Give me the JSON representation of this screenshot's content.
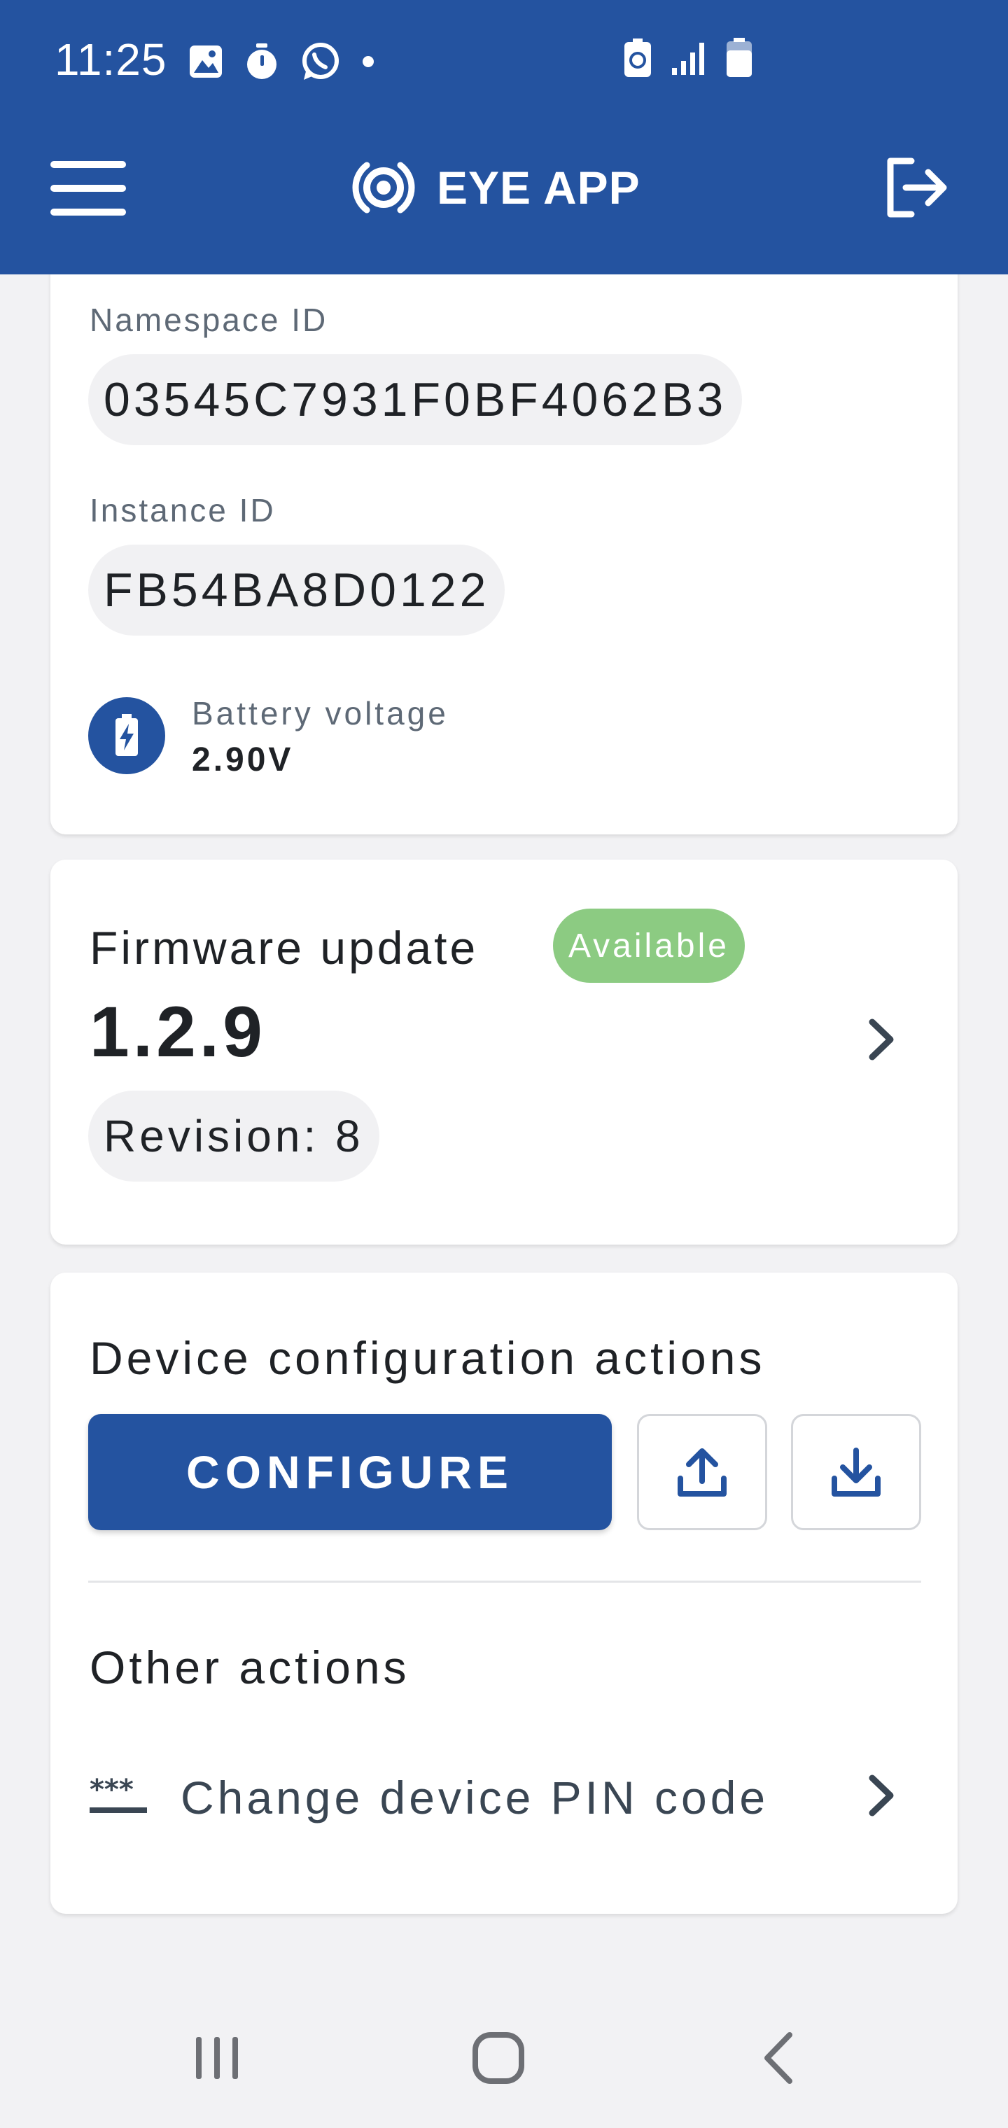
{
  "status_bar": {
    "time": "11:25",
    "icons": [
      "gallery-icon",
      "timer-icon",
      "whatsapp-icon",
      "dot-icon"
    ],
    "right_icons": [
      "battery-saver-icon",
      "signal-icon",
      "battery-icon"
    ]
  },
  "app_bar": {
    "title": "EYE APP",
    "logo_icon": "eye-icon",
    "menu_icon": "hamburger-menu-icon",
    "logout_icon": "logout-icon",
    "color": "#2453a0"
  },
  "device": {
    "namespace_label": "Namespace ID",
    "namespace_value": "03545C7931F0BF4062B3",
    "instance_label": "Instance ID",
    "instance_value": "FB54BA8D0122",
    "battery_label": "Battery voltage",
    "battery_value": "2.90V",
    "battery_icon": "battery-charging-icon"
  },
  "firmware": {
    "title": "Firmware update",
    "badge": "Available",
    "badge_color": "#8ccb82",
    "version": "1.2.9",
    "revision": "Revision: 8",
    "chevron_icon": "chevron-right-icon"
  },
  "actions": {
    "title": "Device configuration actions",
    "configure_label": "CONFIGURE",
    "upload_icon": "upload-icon",
    "download_icon": "download-icon",
    "other_title": "Other actions",
    "pin_label": "Change device PIN code",
    "pin_icon": "password-icon"
  },
  "nav_bar": {
    "buttons": [
      "recents-icon",
      "home-icon",
      "back-icon"
    ]
  }
}
